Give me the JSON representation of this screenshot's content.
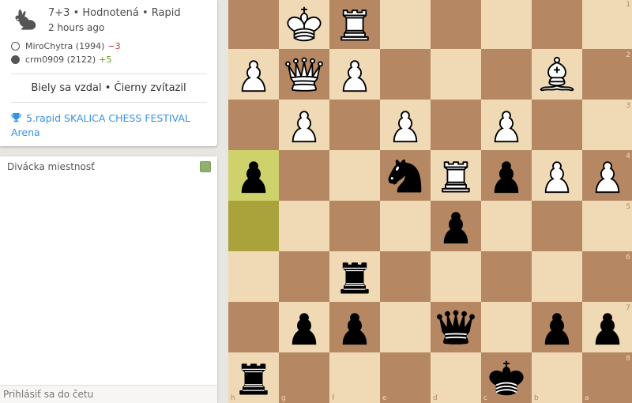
{
  "game": {
    "title": "7+3 • Hodnotená • Rapid",
    "time_ago": "2 hours ago",
    "speed_icon": "rabbit-icon",
    "white_player": {
      "name": "MiroChytra (1994)",
      "rating_diff": "−3"
    },
    "black_player": {
      "name": "crm0909 (2122)",
      "rating_diff": "+5"
    },
    "result": "Biely sa vzdal • Čierny zvítazil",
    "tournament": "5.rapid SKALICA CHESS FESTIVAL Arena"
  },
  "chat": {
    "title": "Divácka miestnosť",
    "placeholder": "Prihlásiť sa do četu"
  },
  "board": {
    "orientation": "black",
    "files": [
      "h",
      "g",
      "f",
      "e",
      "d",
      "c",
      "b",
      "a"
    ],
    "ranks": [
      "1",
      "2",
      "3",
      "4",
      "5",
      "6",
      "7",
      "8"
    ],
    "last_move": [
      "h4",
      "h5"
    ],
    "pieces": {
      "g1": "wK",
      "f1": "wR",
      "h2": "wP",
      "g2": "wQ",
      "f2": "wP",
      "b2": "wB",
      "g3": "wP",
      "e3": "wP",
      "c3": "wP",
      "h4": "bP",
      "e4": "bN",
      "d4": "wR",
      "c4": "bP",
      "b4": "wP",
      "a4": "wP",
      "d5": "bP",
      "f6": "bR",
      "g7": "bP",
      "f7": "bP",
      "d7": "bQ",
      "b7": "bP",
      "a7": "bP",
      "h8": "bR",
      "c8": "bK"
    }
  },
  "colors": {
    "light_square": "#f0d9b5",
    "dark_square": "#b58863",
    "last_move_dark": "#aaa23a",
    "last_move_light": "#cdd26a",
    "link": "#3692e7"
  }
}
